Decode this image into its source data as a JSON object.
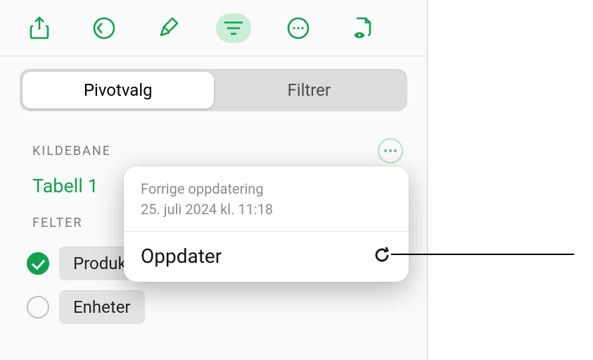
{
  "accent": "#11a04e",
  "toolbar": {
    "share_icon": "share-icon",
    "undo_icon": "undo-icon",
    "format_icon": "paintbrush-icon",
    "organize_icon": "filter-lines-icon",
    "more_icon": "ellipsis-circle-icon",
    "doc_icon": "document-eye-icon"
  },
  "segmented": {
    "pivot_label": "Pivotvalg",
    "filter_label": "Filtrer"
  },
  "source_section": {
    "header": "KILDEBANE",
    "name": "Tabell 1"
  },
  "fields_section": {
    "header": "FELTER",
    "items": [
      {
        "label": "Produkt",
        "checked": true
      },
      {
        "label": "Enheter",
        "checked": false
      }
    ]
  },
  "popover": {
    "caption_line1": "Forrige oppdatering",
    "caption_line2": "25. juli 2024 kl. 11:18",
    "action_label": "Oppdater"
  }
}
